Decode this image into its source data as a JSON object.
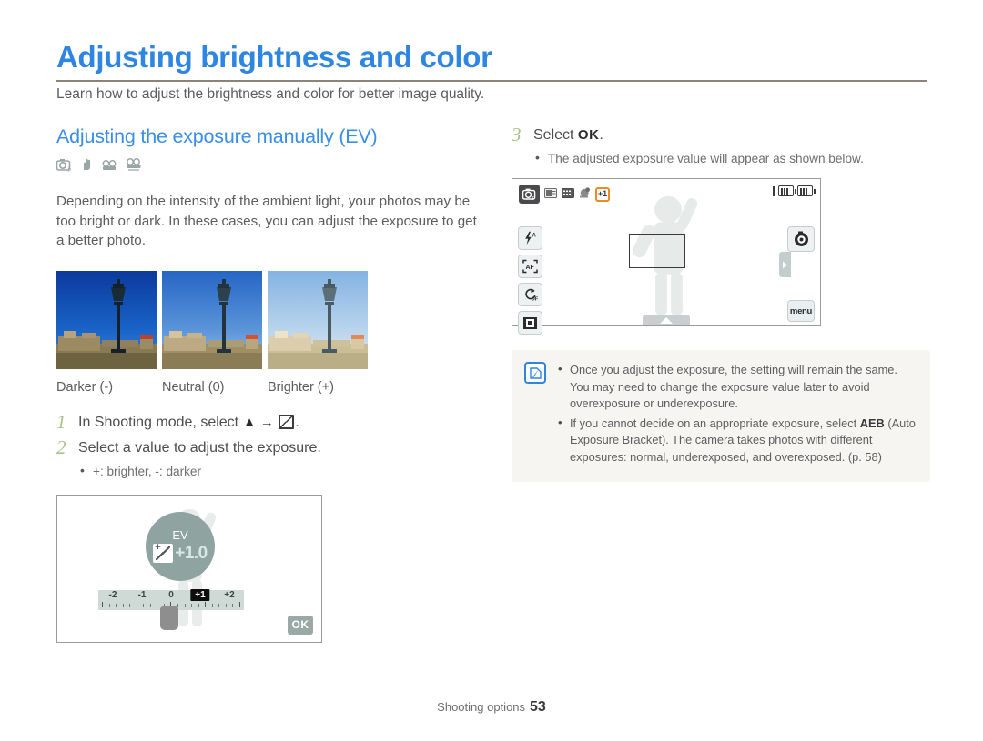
{
  "header": {
    "title": "Adjusting brightness and color",
    "intro": "Learn how to adjust the brightness and color for better image quality.",
    "accent_color": "#2e86e0",
    "rule_color": "#8d8377"
  },
  "left_column": {
    "subheading": "Adjusting the exposure manually (EV)",
    "mode_icons": [
      "camera-program-icon",
      "hand-shake-icon",
      "movie-camera-icon",
      "movie-camera-text-icon"
    ],
    "body": "Depending on the intensity of the ambient light, your photos may be too bright or dark. In these cases, you can adjust the exposure to get a better photo.",
    "samples": [
      {
        "caption": "Darker (-)",
        "name": "sample-photo-darker"
      },
      {
        "caption": "Neutral (0)",
        "name": "sample-photo-neutral"
      },
      {
        "caption": "Brighter (+)",
        "name": "sample-photo-brighter"
      }
    ],
    "steps": [
      {
        "number": "1",
        "text_before": "In Shooting mode, select",
        "arrow": "→",
        "text_after": "."
      },
      {
        "number": "2",
        "text": "Select a value to adjust the exposure.",
        "bullets": [
          "+: brighter, -: darker"
        ]
      }
    ],
    "ev_screen": {
      "ev_label": "EV",
      "ev_value": "+1.0",
      "scale_labels": [
        "-2",
        "-1",
        "0",
        "+1",
        "+2"
      ],
      "selected_label": "+1",
      "ok_label": "OK"
    }
  },
  "right_column": {
    "step": {
      "number": "3",
      "text_before": "Select",
      "ok_label": "OK",
      "text_after": ".",
      "bullets": [
        "The adjusted exposure value will appear as shown below."
      ]
    },
    "preview_screen": {
      "mode_icon": "camera-program-icon",
      "status_icons": [
        "image-size-icon",
        "image-quality-icon",
        "face-detect-icon"
      ],
      "ev_badge": "+1",
      "ev_badge_color": "#f08a1e",
      "left_buttons": [
        "flash-auto-icon",
        "af-frame-icon",
        "timer-off-icon",
        "display-frame-icon"
      ],
      "right_buttons": [
        "shutter-mode-icon",
        "menu-button"
      ],
      "menu_label": "menu"
    },
    "note": {
      "icon": "note-pen-icon",
      "items": [
        "Once you adjust the exposure, the setting will remain the same. You may need to change the exposure value later to avoid overexposure or underexposure.",
        "If you cannot decide on an appropriate exposure, select AEB (Auto Exposure Bracket). The camera takes photos with different exposures: normal, underexposed, and overexposed. (p. 58)"
      ],
      "item2_before": "If you cannot decide on an appropriate exposure, select",
      "item2_bold": "AEB",
      "item2_after": "(Auto Exposure Bracket). The camera takes photos with different exposures: normal, underexposed, and overexposed. (p. 58)"
    }
  },
  "footer": {
    "section": "Shooting options",
    "page_number": "53"
  }
}
